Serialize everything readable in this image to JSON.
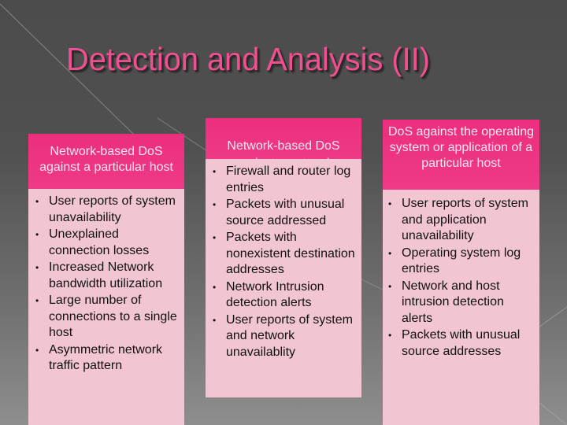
{
  "slide": {
    "title": "Detection and Analysis (II)",
    "colors": {
      "title": "#f0508f",
      "header_bg": "#ed307f",
      "header_text": "#f6e6ef",
      "body_bg": "#f2c5d3",
      "body_text": "#111111",
      "background_top": "#4c4c4c",
      "background_bottom": "#8e8e8e"
    },
    "columns": [
      {
        "header": "Network-based DoS against a particular host",
        "items": [
          "User reports of system unavailability",
          "Unexplained connection losses",
          "Increased Network bandwidth utilization",
          "Large number of connections to a single host",
          "Asymmetric network traffic pattern"
        ]
      },
      {
        "header": "Network-based DoS",
        "header_overflow": "against a network",
        "items": [
          "Firewall and router log entries",
          "Packets with unusual source addressed",
          "Packets with nonexistent destination addresses",
          "Network Intrusion detection alerts",
          "User reports of system and network unavailablity"
        ]
      },
      {
        "header": "DoS against the operating system or application of a particular host",
        "items": [
          "User reports of system and application unavailability",
          "Operating system log entries",
          "Network and host intrusion detection alerts",
          "Packets with unusual source addresses"
        ]
      }
    ],
    "bullet_glyph": "•"
  }
}
